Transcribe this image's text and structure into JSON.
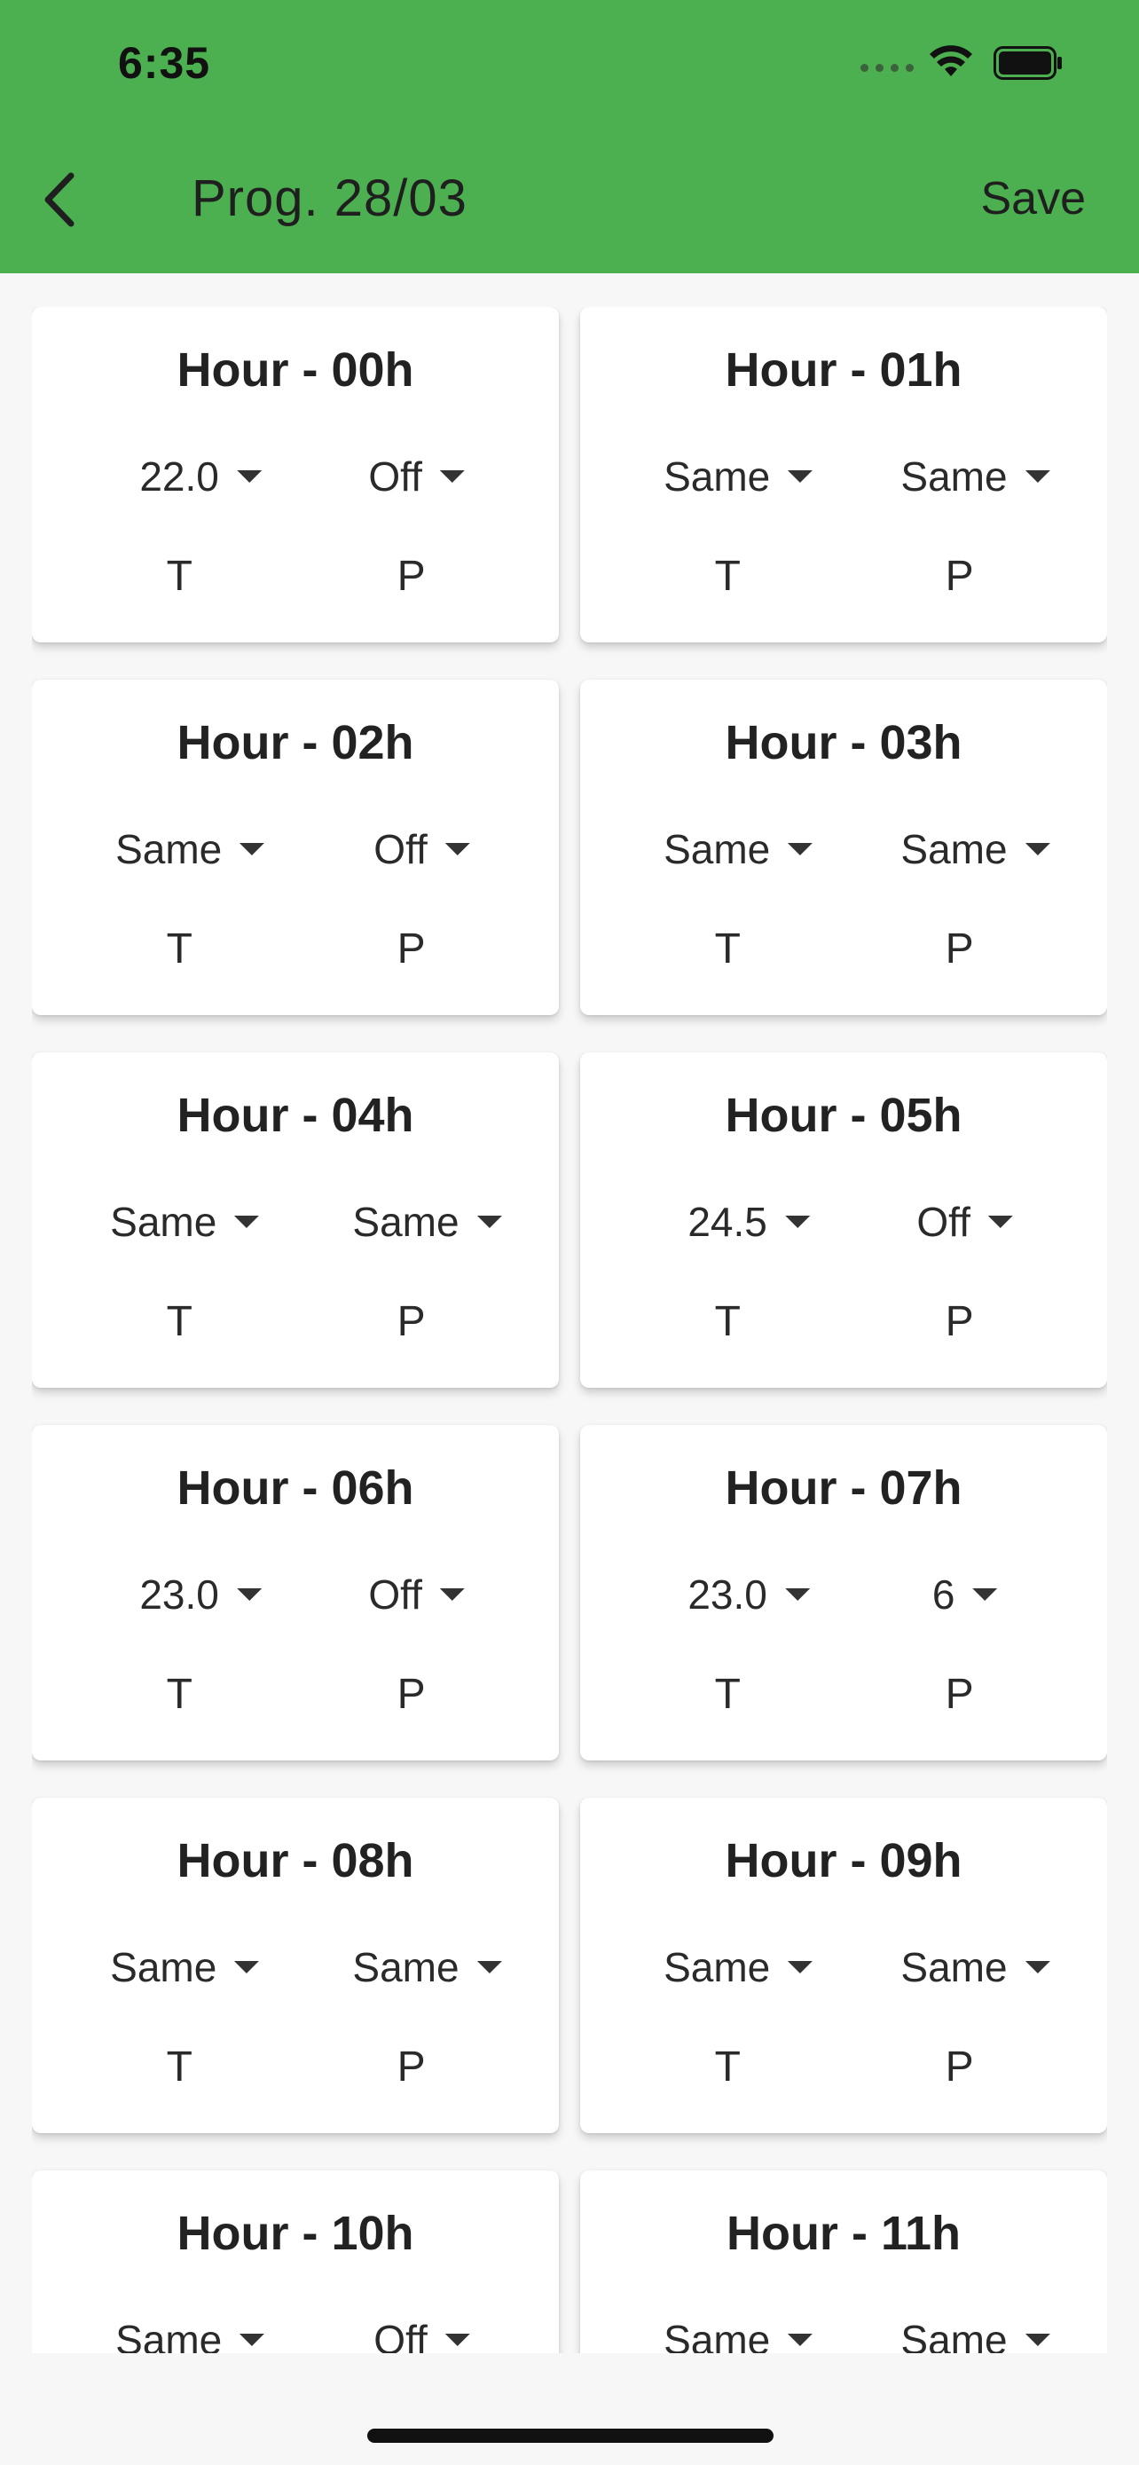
{
  "status": {
    "time": "6:35"
  },
  "header": {
    "title": "Prog. 28/03",
    "save_label": "Save",
    "bg_color": "#4caf50"
  },
  "labels": {
    "t": "T",
    "p": "P"
  },
  "hours": [
    {
      "title": "Hour - 00h",
      "t": "22.0",
      "p": "Off"
    },
    {
      "title": "Hour - 01h",
      "t": "Same",
      "p": "Same"
    },
    {
      "title": "Hour - 02h",
      "t": "Same",
      "p": "Off"
    },
    {
      "title": "Hour - 03h",
      "t": "Same",
      "p": "Same"
    },
    {
      "title": "Hour - 04h",
      "t": "Same",
      "p": "Same"
    },
    {
      "title": "Hour - 05h",
      "t": "24.5",
      "p": "Off"
    },
    {
      "title": "Hour - 06h",
      "t": "23.0",
      "p": "Off"
    },
    {
      "title": "Hour - 07h",
      "t": "23.0",
      "p": "6"
    },
    {
      "title": "Hour - 08h",
      "t": "Same",
      "p": "Same"
    },
    {
      "title": "Hour - 09h",
      "t": "Same",
      "p": "Same"
    },
    {
      "title": "Hour - 10h",
      "t": "Same",
      "p": "Off"
    },
    {
      "title": "Hour - 11h",
      "t": "Same",
      "p": "Same"
    }
  ]
}
